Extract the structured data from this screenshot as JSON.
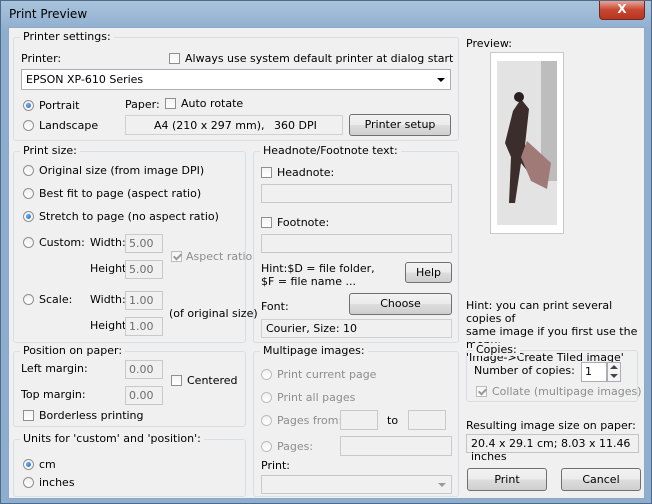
{
  "window": {
    "title": "Print Preview",
    "close_glyph": "X"
  },
  "printer_settings": {
    "group_label": "Printer settings:",
    "printer_label": "Printer:",
    "always_default_label": "Always use system default printer at dialog start",
    "printer_value": "EPSON XP-610 Series",
    "portrait_label": "Portrait",
    "landscape_label": "Landscape",
    "paper_label": "Paper:",
    "auto_rotate_label": "Auto rotate",
    "paper_size": "A4 (210 x 297 mm),",
    "dpi": "360 DPI",
    "printer_setup_label": "Printer setup"
  },
  "print_size": {
    "group_label": "Print size:",
    "original_label": "Original size (from image DPI)",
    "bestfit_label": "Best fit to page (aspect ratio)",
    "stretch_label": "Stretch to page (no aspect ratio)",
    "custom_label": "Custom:",
    "width_label": "Width:",
    "height_label": "Height:",
    "custom_width": "5.00",
    "custom_height": "5.00",
    "aspect_label": "Aspect ratio",
    "scale_label": "Scale:",
    "scale_width": "1.00",
    "scale_height": "1.00",
    "of_original_label": "(of original size)"
  },
  "headnote": {
    "group_label": "Headnote/Footnote text:",
    "headnote_label": "Headnote:",
    "footnote_label": "Footnote:",
    "hint_line1": "Hint:$D = file folder,",
    "hint_line2": "$F = file name ...",
    "help_label": "Help",
    "font_label": "Font:",
    "choose_label": "Choose",
    "font_value": "Courier, Size: 10"
  },
  "preview": {
    "label": "Preview:",
    "hint_line1": "Hint: you can print several copies of",
    "hint_line2": "same image if you first use the menu:",
    "hint_line3": "'Image->Create Tiled image'"
  },
  "position": {
    "group_label": "Position on paper:",
    "left_margin_label": "Left margin:",
    "left_margin": "0.00",
    "top_margin_label": "Top margin:",
    "top_margin": "0.00",
    "centered_label": "Centered",
    "borderless_label": "Borderless printing"
  },
  "units": {
    "group_label": "Units for 'custom' and 'position':",
    "cm_label": "cm",
    "inches_label": "inches"
  },
  "multipage": {
    "group_label": "Multipage images:",
    "current_label": "Print current page",
    "all_label": "Print all pages",
    "from_label": "Pages from:",
    "to_label": "to",
    "pages_label": "Pages:",
    "print_label": "Print:"
  },
  "copies": {
    "group_label": "Copies:",
    "number_label": "Number of copies:",
    "number": "1",
    "collate_label": "Collate (multipage images)"
  },
  "result": {
    "label": "Resulting image size on paper:",
    "value": "20.4 x 29.1 cm; 8.03 x 11.46 inches"
  },
  "footer": {
    "print_label": "Print",
    "cancel_label": "Cancel"
  }
}
